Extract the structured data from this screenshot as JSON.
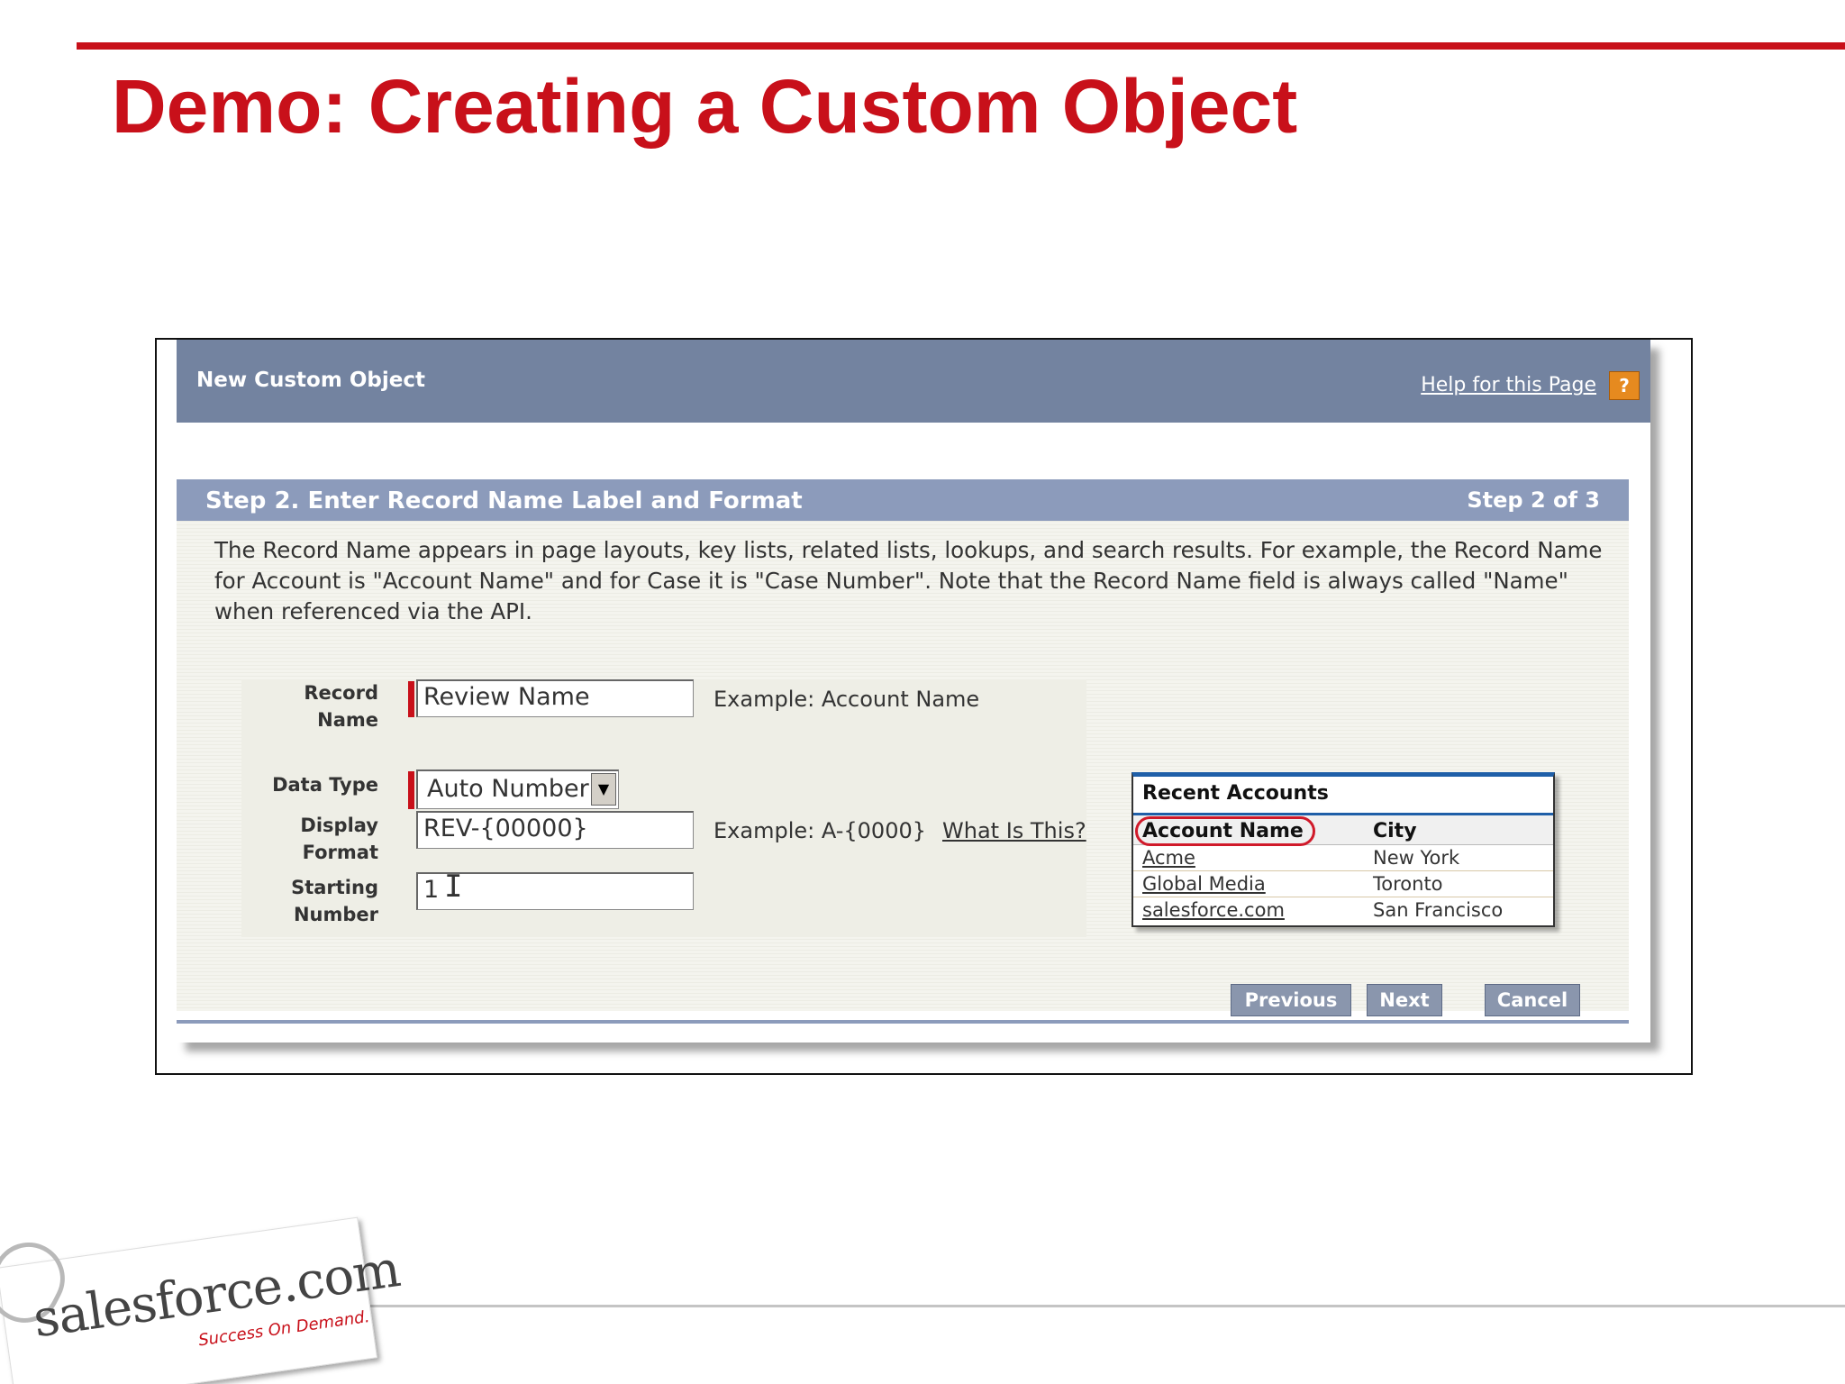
{
  "slide": {
    "title": "Demo: Creating a Custom Object"
  },
  "app": {
    "header_title": "New Custom Object",
    "help_link": "Help for this Page",
    "help_icon": "?",
    "step_title": "Step 2. Enter Record Name Label and Format",
    "step_count": "Step 2 of 3",
    "description": "The Record Name appears in page layouts, key lists, related lists, lookups, and search results. For example, the Record Name for Account is \"Account Name\" and for Case it is \"Case Number\". Note that the Record Name field is always called \"Name\" when referenced via the API.",
    "form": {
      "record_name_label": "Record Name",
      "record_name_value": "Review Name",
      "record_name_example": "Example:  Account Name",
      "data_type_label": "Data Type",
      "data_type_value": "Auto Number",
      "display_format_label": "Display Format",
      "display_format_value": "REV-{00000}",
      "display_format_example": "Example:  A-{0000}",
      "what_is_this": "What Is This?",
      "starting_number_label": "Starting Number",
      "starting_number_value": "1"
    },
    "recent_accounts": {
      "title": "Recent Accounts",
      "columns": [
        "Account Name",
        "City"
      ],
      "rows": [
        {
          "name": "Acme",
          "city": "New York"
        },
        {
          "name": "Global Media",
          "city": "Toronto"
        },
        {
          "name": "salesforce.com",
          "city": "San Francisco"
        }
      ]
    },
    "buttons": {
      "previous": "Previous",
      "next": "Next",
      "cancel": "Cancel"
    }
  },
  "footer": {
    "logo_text": "salesforce.com",
    "logo_tagline": "Success On Demand."
  },
  "colors": {
    "accent_red": "#c8101a",
    "header_blue": "#7383a0",
    "step_bar": "#8c9bbb"
  }
}
